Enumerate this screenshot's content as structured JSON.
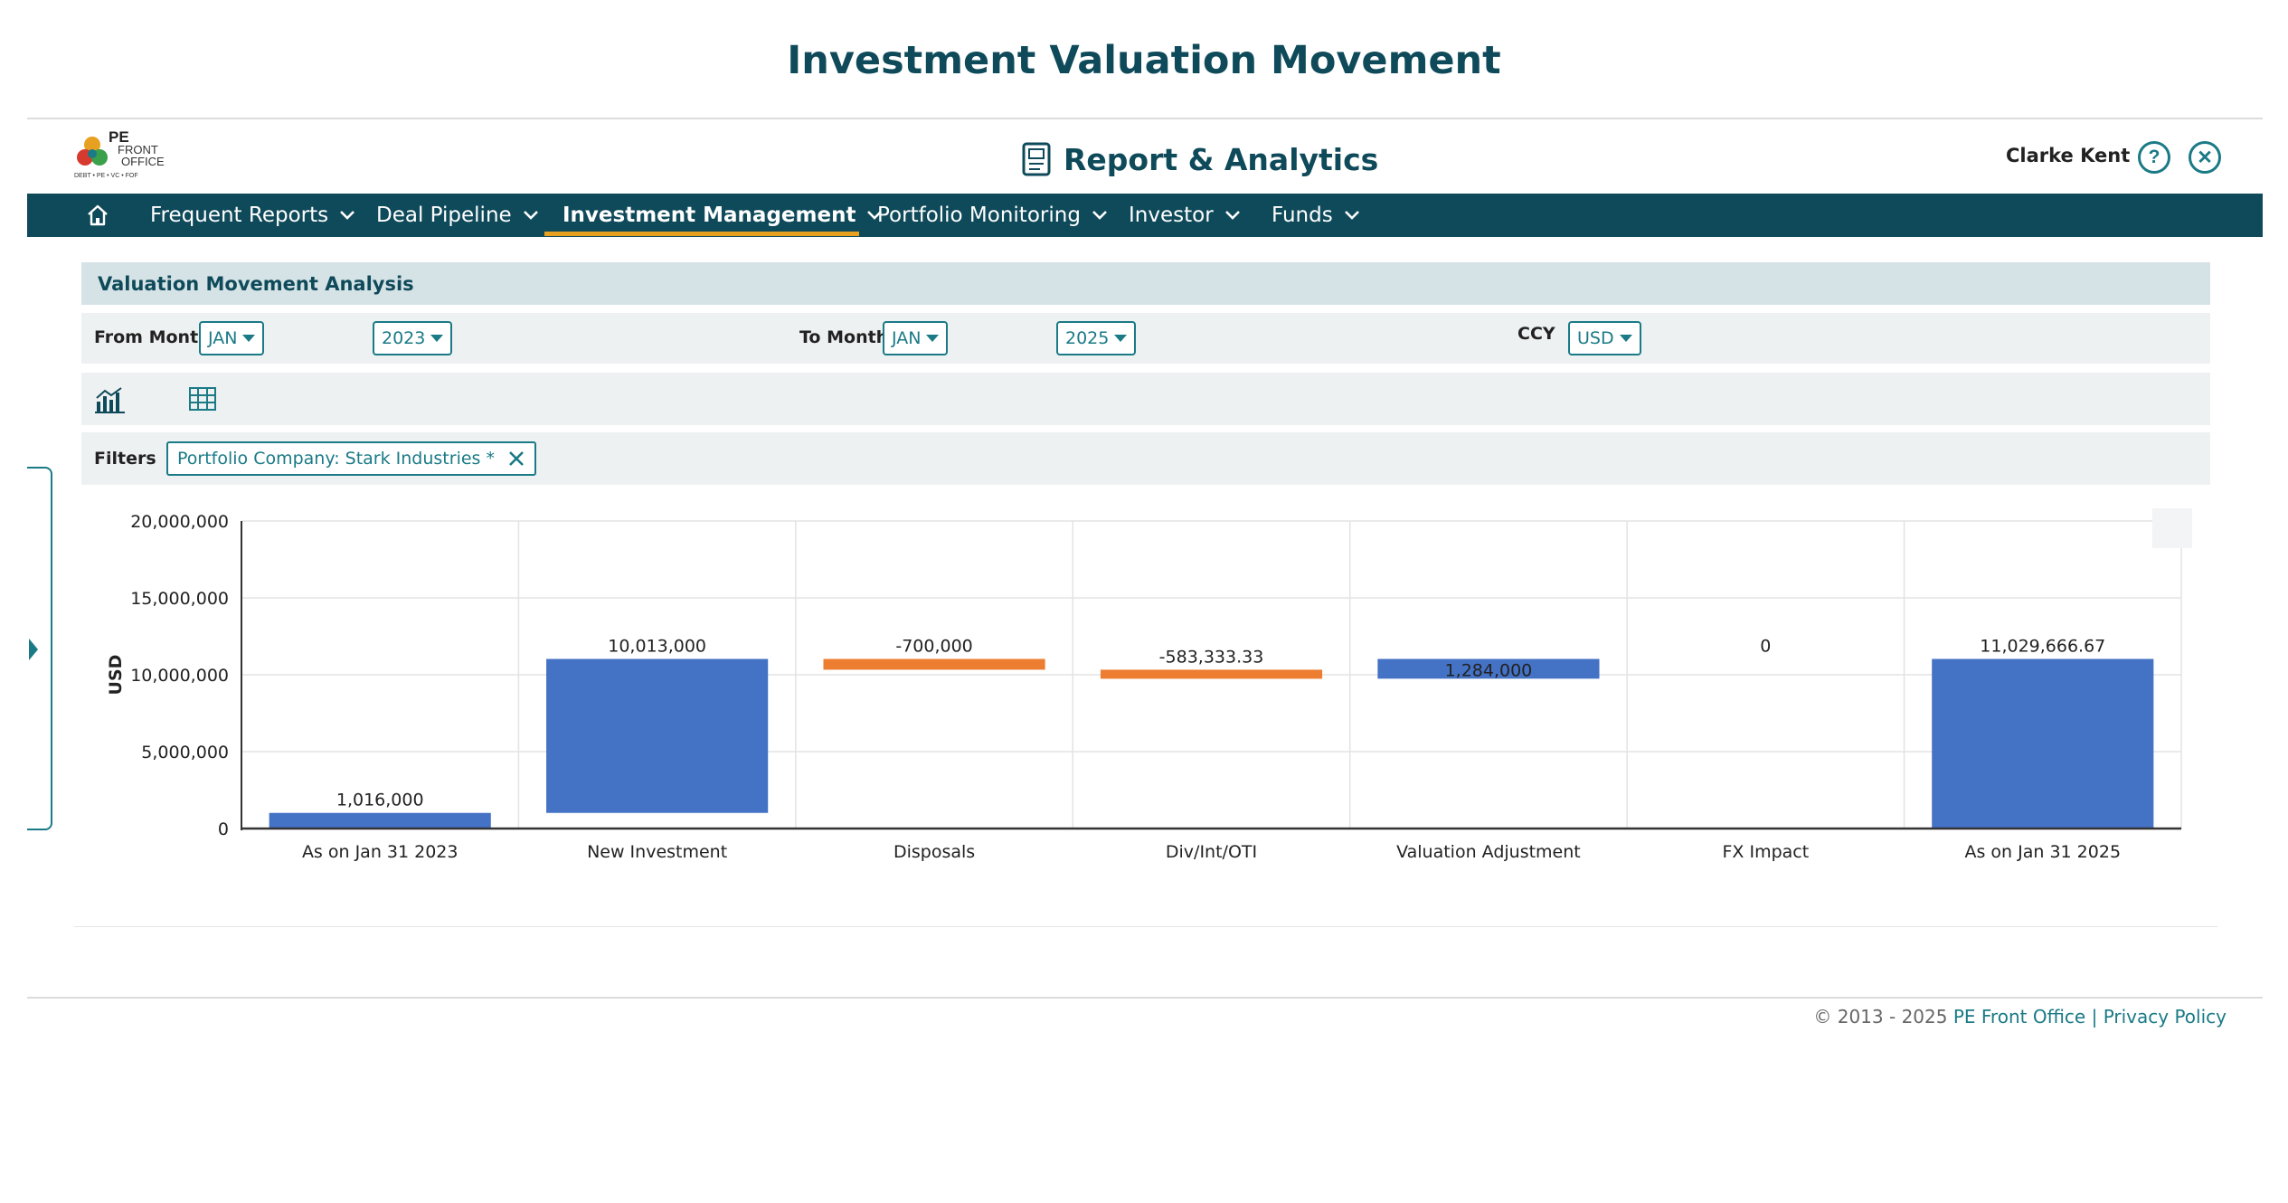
{
  "page_title": "Investment Valuation Movement",
  "header": {
    "logo_text": [
      "PE",
      "FRONT",
      "OFFICE"
    ],
    "logo_tagline": "DEBT • PE • VC • FOF",
    "title": "Report & Analytics",
    "user": "Clarke Kent",
    "help_icon": "help-icon",
    "close_icon": "close-circle-icon"
  },
  "nav": {
    "home_icon": "home-icon",
    "items": [
      {
        "label": "Frequent Reports"
      },
      {
        "label": "Deal Pipeline"
      },
      {
        "label": "Investment Management",
        "active": true
      },
      {
        "label": "Portfolio Monitoring"
      },
      {
        "label": "Investor"
      },
      {
        "label": "Funds"
      }
    ],
    "active_color": "#e8a020",
    "bar_color": "#0f4a5a"
  },
  "panel": {
    "title": "Valuation Movement Analysis",
    "from_label": "From Month",
    "from_month": "JAN",
    "from_year": "2023",
    "to_label": "To Month",
    "to_month": "JAN",
    "to_year": "2025",
    "ccy_label": "CCY",
    "ccy": "USD",
    "view_icons": [
      "bar-chart-icon",
      "table-icon"
    ],
    "filters_label": "Filters",
    "filter_chip": "Portfolio Company: Stark Industries *"
  },
  "chart_data": {
    "type": "bar",
    "subtype": "waterfall",
    "ylabel": "USD",
    "ylim": [
      0,
      20000000
    ],
    "yticks": [
      "0",
      "5,000,000",
      "10,000,000",
      "15,000,000",
      "20,000,000"
    ],
    "grid": true,
    "colors": {
      "increase": "#4472c4",
      "decrease": "#ed7d31"
    },
    "bars": [
      {
        "category": "As on Jan 31 2023",
        "start": 0,
        "end": 1016000,
        "label": "1,016,000",
        "kind": "total"
      },
      {
        "category": "New Investment",
        "start": 1016000,
        "end": 11029000,
        "label": "10,013,000",
        "kind": "increase"
      },
      {
        "category": "Disposals",
        "start": 11029000,
        "end": 10329000,
        "label": "-700,000",
        "kind": "decrease"
      },
      {
        "category": "Div/Int/OTI",
        "start": 10329000,
        "end": 9745666.67,
        "label": "-583,333.33",
        "kind": "decrease"
      },
      {
        "category": "Valuation Adjustment",
        "start": 9745666.67,
        "end": 11029666.67,
        "label": "1,284,000",
        "kind": "increase"
      },
      {
        "category": "FX Impact",
        "start": 11029666.67,
        "end": 11029666.67,
        "label": "0",
        "kind": "increase"
      },
      {
        "category": "As on Jan 31 2025",
        "start": 0,
        "end": 11029666.67,
        "label": "11,029,666.67",
        "kind": "total"
      }
    ]
  },
  "footer": {
    "copyright": "© 2013 - 2025",
    "company": "PE Front Office",
    "separator": "|",
    "privacy": "Privacy Policy"
  }
}
